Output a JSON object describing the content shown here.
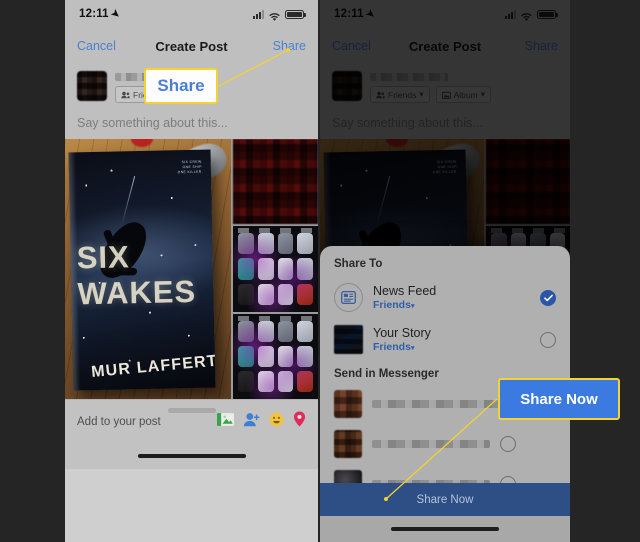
{
  "status_bar": {
    "time": "12:11",
    "location_icon": "location-arrow-icon",
    "signal_icon": "cellular-signal-icon",
    "wifi_icon": "wifi-icon",
    "battery_icon": "battery-full-icon"
  },
  "nav": {
    "cancel_label": "Cancel",
    "title": "Create Post",
    "share_label": "Share"
  },
  "composer": {
    "audience_chip": "Friends",
    "audience_caret": "▾",
    "album_chip": "Album",
    "album_caret": "▾",
    "placeholder": "Say something about this..."
  },
  "photo": {
    "book_tagline_1": "SIX CREW.",
    "book_tagline_2": "ONE SHIP.",
    "book_tagline_3": "ONE KILLER.",
    "book_title": "SIX WAKES",
    "book_author": "MUR LAFFERTY"
  },
  "add_bar": {
    "label": "Add to your post",
    "icons": [
      "photo-icon",
      "tag-people-icon",
      "feeling-icon",
      "location-pin-icon"
    ]
  },
  "share_sheet": {
    "title": "Share To",
    "options": [
      {
        "icon": "news-feed-icon",
        "label": "News Feed",
        "audience": "Friends",
        "audience_caret": "▾",
        "selected": true
      },
      {
        "icon": "your-story-thumbnail",
        "label": "Your Story",
        "audience": "Friends",
        "audience_caret": "▾",
        "selected": false
      }
    ],
    "messenger_title": "Send in Messenger",
    "messenger_contacts": [
      {
        "avatar": "contact-avatar-1",
        "name_hidden": true,
        "selected": false
      },
      {
        "avatar": "contact-avatar-2",
        "name_hidden": true,
        "selected": false
      },
      {
        "avatar": "contact-avatar-3",
        "name_hidden": true,
        "selected": false
      }
    ],
    "share_now_label": "Share Now"
  },
  "annotations": [
    {
      "id": "callout-share",
      "label": "Share",
      "style": "white-box-blue-text"
    },
    {
      "id": "callout-sharenow",
      "label": "Share Now",
      "style": "blue-box-white-text"
    }
  ],
  "colors": {
    "highlight_border": "#f5d32e",
    "facebook_blue": "#3b7ae0",
    "link_blue": "#4a7fd4",
    "share_bar_blue": "#2d4f86",
    "backdrop": "#252525"
  }
}
